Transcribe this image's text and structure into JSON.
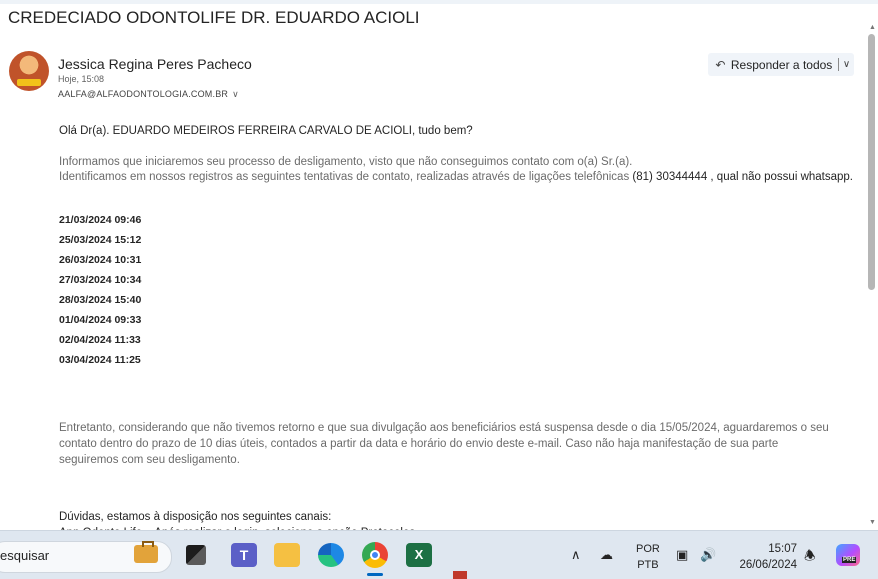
{
  "email": {
    "subject": "CREDECIADO ODONTOLIFE DR. EDUARDO ACIOLI",
    "sender_name": "Jessica Regina Peres Pacheco",
    "time": "Hoje, 15:08",
    "sender_email": "AALFA@ALFAODONTOLOGIA.COM.BR",
    "reply_all_label": "Responder a todos",
    "greeting": "Olá Dr(a). EDUARDO MEDEIROS FERREIRA CARVALO DE ACIOLI, tudo bem?",
    "para1": "Informamos que iniciaremos seu processo de desligamento, visto que não conseguimos contato com o(a) Sr.(a).",
    "para2_prefix": "Identificamos em nossos registros as seguintes tentativas de contato, realizadas através de ligações telefônicas",
    "para2_phone": "(81) 30344444",
    "para2_suffix": ", qual não possui whatsapp.",
    "contact_dates": [
      "21/03/2024 09:46",
      "25/03/2024 15:12",
      "26/03/2024 10:31",
      "27/03/2024 10:34",
      "28/03/2024 15:40",
      "01/04/2024 09:33",
      "02/04/2024 11:33",
      "03/04/2024 11:25"
    ],
    "para3": "Entretanto, considerando que não tivemos retorno e que sua divulgação aos beneficiários está suspensa desde o dia 15/05/2024, aguardaremos o seu contato dentro do prazo de 10 dias úteis, contados a partir da data e horário do envio deste e-mail. Caso não haja manifestação de sua parte seguiremos com seu desligamento.",
    "doubts": "Dúvidas, estamos à disposição nos seguintes canais:",
    "cut_line": "App Odonto Life – Após realizar o login, selecione a opção Protocolos"
  },
  "taskbar": {
    "search_text": "esquisar",
    "lang_top": "POR",
    "lang_bottom": "PTB",
    "clock_time": "15:07",
    "clock_date": "26/06/2024",
    "copilot_badge": "PRE",
    "excel_letter": "X",
    "teams_letter": "T"
  }
}
